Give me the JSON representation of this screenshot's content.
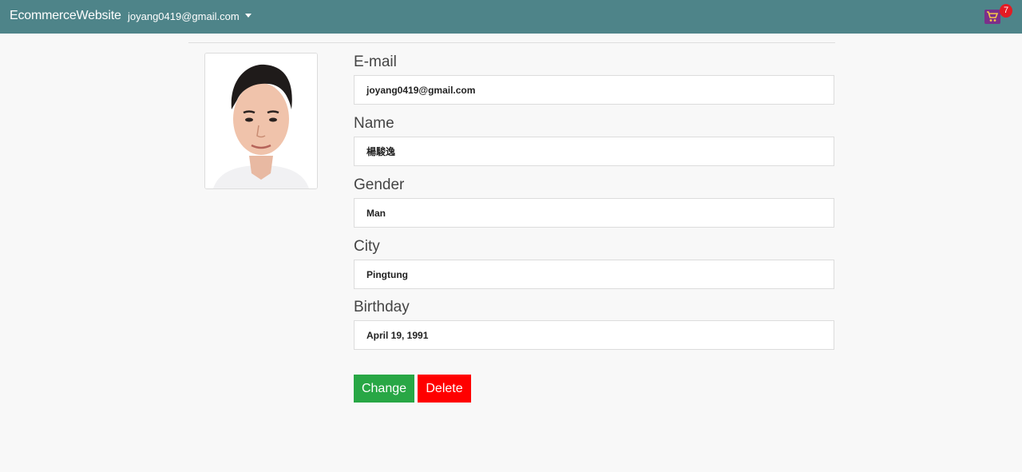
{
  "navbar": {
    "brand": "EcommerceWebsite",
    "user_email": "joyang0419@gmail.com",
    "cart_icon": "shopping-cart-icon",
    "cart_count": "7"
  },
  "profile": {
    "fields": [
      {
        "label": "E-mail",
        "value": "joyang0419@gmail.com"
      },
      {
        "label": "Name",
        "value": "楊駿逸"
      },
      {
        "label": "Gender",
        "value": "Man"
      },
      {
        "label": "City",
        "value": "Pingtung"
      },
      {
        "label": "Birthday",
        "value": "April 19, 1991"
      }
    ],
    "change_label": "Change",
    "delete_label": "Delete"
  },
  "colors": {
    "navbar": "#4e8489",
    "change": "#28a745",
    "delete": "#ff0000",
    "badge": "#e31b23"
  }
}
